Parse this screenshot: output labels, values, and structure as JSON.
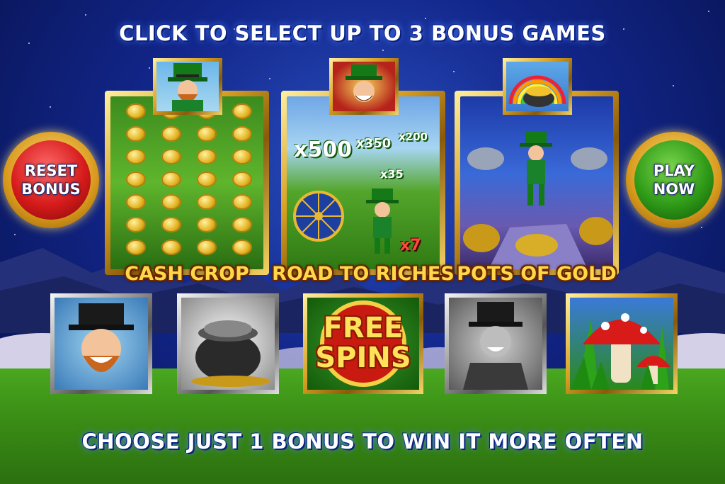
{
  "header": {
    "instruction": "CLICK TO SELECT UP TO 3 BONUS GAMES"
  },
  "buttons": {
    "reset": {
      "line1": "RESET",
      "line2": "BONUS"
    },
    "play": {
      "line1": "PLAY",
      "line2": "NOW"
    }
  },
  "bonus_games": [
    {
      "name": "CASH CROP",
      "badge_icon": "leprechaun-icon"
    },
    {
      "name": "ROAD TO RICHES",
      "badge_icon": "leprechaun-face-icon",
      "multipliers": [
        "x500",
        "x350",
        "x200",
        "x35",
        "x7"
      ]
    },
    {
      "name": "POTS OF GOLD",
      "badge_icon": "rainbow-pot-icon"
    }
  ],
  "symbols": [
    {
      "icon": "leprechaun-icon",
      "style": "silver"
    },
    {
      "icon": "pot-of-gold-icon",
      "style": "silver"
    },
    {
      "icon": "free-spins-icon",
      "style": "gold",
      "line1": "FREE",
      "line2": "SPINS"
    },
    {
      "icon": "leprechaun-grey-icon",
      "style": "silver"
    },
    {
      "icon": "mushroom-icon",
      "style": "gold"
    }
  ],
  "footer": {
    "tip": "CHOOSE JUST 1 BONUS TO WIN IT MORE OFTEN"
  },
  "colors": {
    "gold": "#d8a022",
    "reset_red": "#d61b1b",
    "play_green": "#2f9a18",
    "sky": "#12268a"
  }
}
